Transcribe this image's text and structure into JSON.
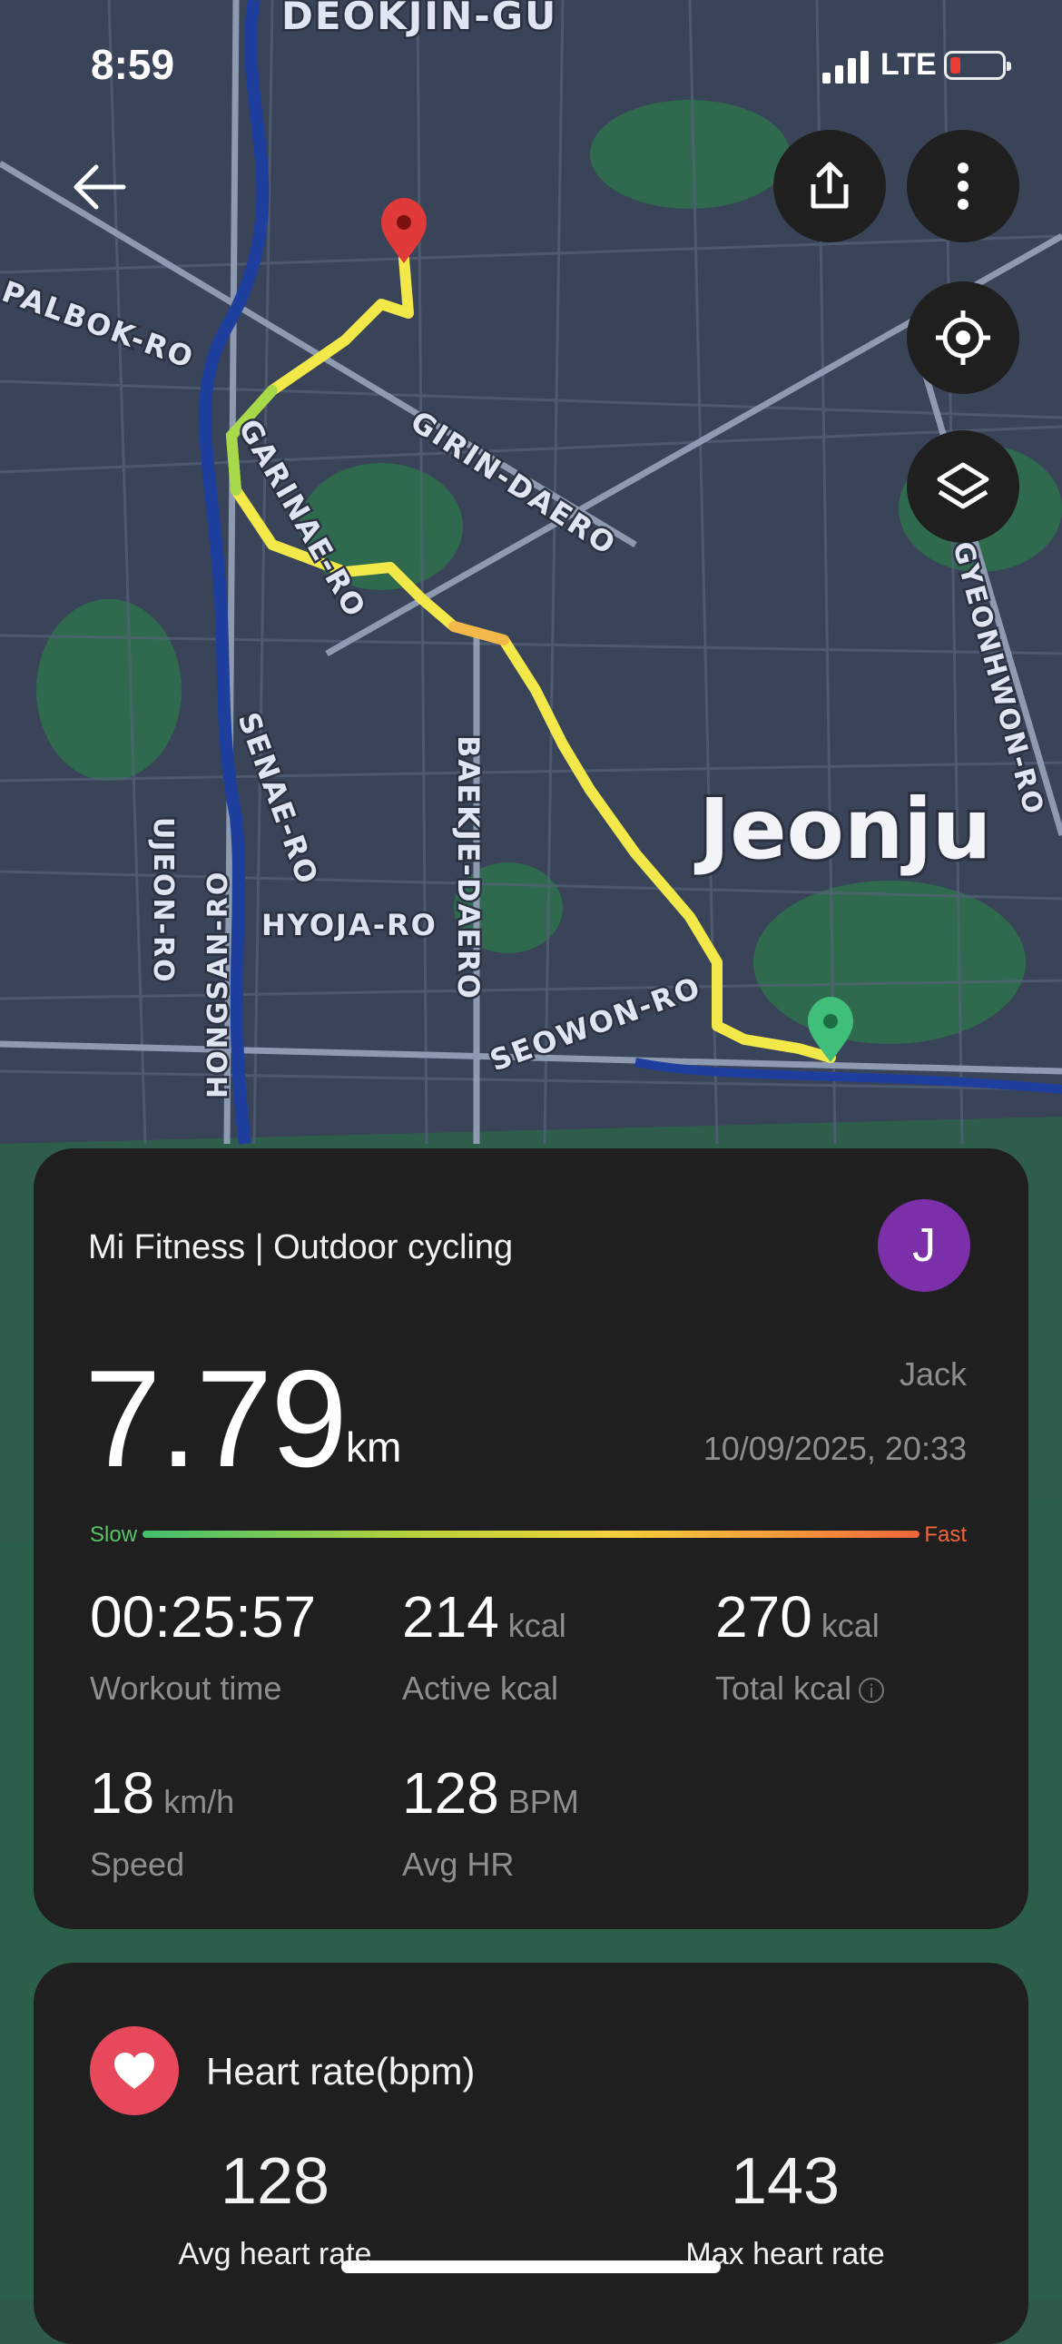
{
  "status_bar": {
    "time": "8:59",
    "network": "LTE"
  },
  "map": {
    "city_label": "Jeonju",
    "district_label": "DEOKJIN-GU",
    "roads": [
      "PALBOK-RO",
      "GIRIN-DAERO",
      "GARINAE-RO",
      "SENAE-RO",
      "BAEKJE-DAERO",
      "HYOJA-RO",
      "UJEON-RO",
      "HONGSAN-RO",
      "SEOWON-RO",
      "GYEONHWON-RO"
    ]
  },
  "workout": {
    "app_title": "Mi Fitness | Outdoor cycling",
    "avatar_initial": "J",
    "distance_value": "7.79",
    "distance_unit": "km",
    "user_name": "Jack",
    "datetime": "10/09/2025, 20:33",
    "pace_scale": {
      "slow_label": "Slow",
      "fast_label": "Fast"
    },
    "metrics": [
      {
        "value": "00:25:57",
        "unit": "",
        "label": "Workout time"
      },
      {
        "value": "214",
        "unit": "kcal",
        "label": "Active kcal"
      },
      {
        "value": "270",
        "unit": "kcal",
        "label": "Total kcal"
      },
      {
        "value": "18",
        "unit": "km/h",
        "label": "Speed"
      },
      {
        "value": "128",
        "unit": "BPM",
        "label": "Avg HR"
      }
    ]
  },
  "heart_rate": {
    "title": "Heart rate(bpm)",
    "avg_value": "128",
    "avg_label": "Avg heart rate",
    "max_value": "143",
    "max_label": "Max heart rate"
  },
  "colors": {
    "card_bg": "#1f1f1f",
    "accent_avatar": "#7b2fa8",
    "heart_badge": "#e8485b",
    "route": "#f2e84a",
    "start_pin": "#3fbf7a",
    "end_pin": "#e03a3a"
  },
  "icons": [
    "back-arrow-icon",
    "share-icon",
    "more-vertical-icon",
    "locate-icon",
    "layers-icon",
    "info-icon",
    "heart-icon"
  ]
}
